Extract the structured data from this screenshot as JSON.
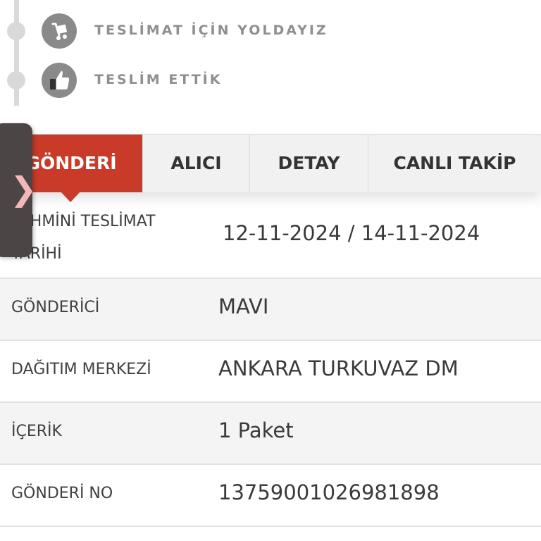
{
  "timeline": {
    "steps": [
      {
        "label": "TESLİMAT İÇİN YOLDAYIZ",
        "icon": "delivery-cart-icon"
      },
      {
        "label": "TESLİM ETTİK",
        "icon": "thumbs-up-icon"
      }
    ]
  },
  "tabs": [
    {
      "label": "GÖNDERİ",
      "active": true
    },
    {
      "label": "ALICI",
      "active": false
    },
    {
      "label": "DETAY",
      "active": false
    },
    {
      "label": "CANLI TAKİP",
      "active": false
    }
  ],
  "details": {
    "rows": [
      {
        "label": "TAHMİNİ TESLİMAT TARİHİ",
        "value": "12-11-2024 / 14-11-2024"
      },
      {
        "label": "GÖNDERİCİ",
        "value": "MAVI"
      },
      {
        "label": "DAĞITIM MERKEZİ",
        "value": "ANKARA TURKUVAZ DM"
      },
      {
        "label": "İÇERİK",
        "value": "1 Paket"
      },
      {
        "label": "GÖNDERİ NO",
        "value": "13759001026981898"
      }
    ]
  },
  "side_handle": {
    "icon": "chevron-right-icon",
    "glyph": "❯"
  },
  "colors": {
    "accent": "#c93a28",
    "handle": "#4b4545",
    "muted_text": "#8f8f8f"
  }
}
